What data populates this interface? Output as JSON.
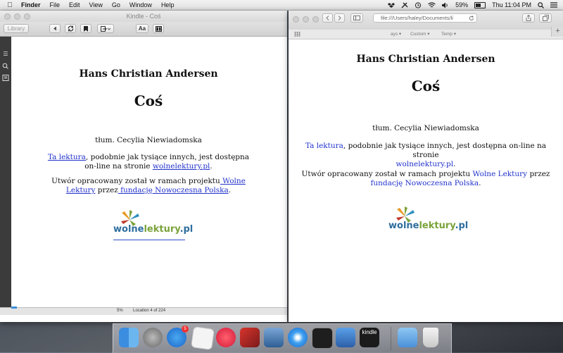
{
  "menubar": {
    "app": "Finder",
    "items": [
      "File",
      "Edit",
      "View",
      "Go",
      "Window",
      "Help"
    ],
    "battery": "59%",
    "clock": "Thu 11:04 PM"
  },
  "kindle": {
    "window_title": "Kindle - Coś",
    "library_label": "Library",
    "font_button": "Aa",
    "book": {
      "author": "Hans Christian Andersen",
      "title": "Coś",
      "translator": "tłum. Cecylia Niewiadomska",
      "p1_link": "Ta lektura",
      "p1_text1": ", podobnie jak tysiące innych, jest dostępna",
      "p1_text2": "on-line na stronie ",
      "p1_link2": "wolnelektury.pl",
      "p1_end": ".",
      "p2_text1": "Utwór opracowany został w ramach projektu",
      "p2_link1a": " Wolne",
      "p2_link1b": "Lektury",
      "p2_mid": " przez",
      "p2_link2": " fundację Nowoczesna Polska",
      "p2_end": "."
    },
    "status": {
      "percent": "5%",
      "location": "Location 4 of 224"
    }
  },
  "safari": {
    "url": "file:///Users/haley/Documents/li",
    "bookmarks": [
      "ays ▾",
      "Custom ▾",
      "Temp ▾"
    ],
    "book": {
      "author": "Hans Christian Andersen",
      "title": "Coś",
      "translator": "tłum. Cecylia Niewiadomska",
      "p1_link": "Ta lektura",
      "p1_text1": ", podobnie jak tysiące innych, jest dostępna on-line na stronie",
      "p1_link2": "wolnelektury.pl",
      "p1_end": ".",
      "p2_text1": "Utwór opracowany został w ramach projektu ",
      "p2_link1": "Wolne Lektury",
      "p2_mid": " przez",
      "p2_link2": "fundację Nowoczesna Polska",
      "p2_end": "."
    }
  },
  "logo": {
    "part1": "wolne",
    "part2": "lektury",
    "part3": ".pl"
  },
  "dock": {
    "app_store_badge": "5",
    "kindle_label": "kindle"
  }
}
